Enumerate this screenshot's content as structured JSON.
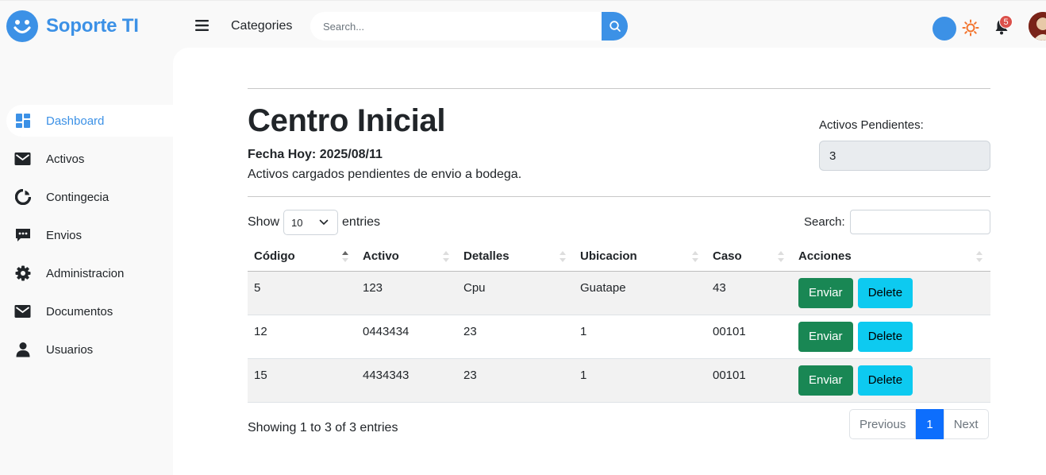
{
  "brand": {
    "name": "Soporte TI"
  },
  "topbar": {
    "categories_label": "Categories",
    "search_placeholder": "Search...",
    "notification_count": "5"
  },
  "sidebar": {
    "items": [
      {
        "label": "Dashboard",
        "icon": "dashboard-icon",
        "active": true
      },
      {
        "label": "Activos",
        "icon": "envelope-icon"
      },
      {
        "label": "Contingecia",
        "icon": "doughnut-chart-icon"
      },
      {
        "label": "Envios",
        "icon": "message-dots-icon"
      },
      {
        "label": "Administracion",
        "icon": "gear-icon"
      },
      {
        "label": "Documentos",
        "icon": "envelope-icon"
      },
      {
        "label": "Usuarios",
        "icon": "user-icon"
      }
    ]
  },
  "main": {
    "title": "Centro Inicial",
    "fecha": "Fecha Hoy: 2025/08/11",
    "subtitle": "Activos cargados pendientes de envio a bodega.",
    "pendientes_label": "Activos Pendientes:",
    "pendientes_value": "3"
  },
  "table_controls": {
    "show_label": "Show",
    "entries_value": "10",
    "entries_label": "entries",
    "search_label": "Search:"
  },
  "table": {
    "columns": [
      "Código",
      "Activo",
      "Detalles",
      "Ubicacion",
      "Caso",
      "Acciones"
    ],
    "rows": [
      {
        "codigo": "5",
        "activo": "123",
        "detalles": "Cpu",
        "ubicacion": "Guatape",
        "caso": "43"
      },
      {
        "codigo": "12",
        "activo": "0443434",
        "detalles": "23",
        "ubicacion": "1",
        "caso": "00101"
      },
      {
        "codigo": "15",
        "activo": "4434343",
        "detalles": "23",
        "ubicacion": "1",
        "caso": "00101"
      }
    ],
    "send_label": "Enviar",
    "delete_label": "Delete"
  },
  "footer": {
    "info": "Showing 1 to 3 of 3 entries",
    "previous": "Previous",
    "current_page": "1",
    "next": "Next"
  },
  "colors": {
    "accent": "#3c91e6",
    "send": "#198754",
    "delete": "#0dcaf0",
    "page_active": "#0d6efd",
    "badge": "#db504a"
  }
}
